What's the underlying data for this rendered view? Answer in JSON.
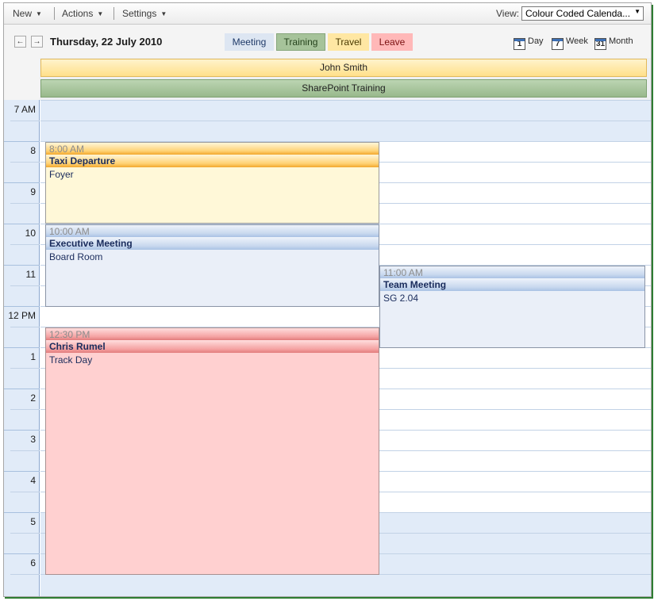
{
  "toolbar": {
    "new_label": "New",
    "actions_label": "Actions",
    "settings_label": "Settings",
    "view_label": "View:",
    "view_value": "Colour Coded Calenda..."
  },
  "header": {
    "prev_icon": "arrow-left-icon",
    "next_icon": "arrow-right-icon",
    "prev_glyph": "←",
    "next_glyph": "→",
    "date": "Thursday, 22 July 2010"
  },
  "legend": {
    "meeting": "Meeting",
    "training": "Training",
    "travel": "Travel",
    "leave": "Leave"
  },
  "views": {
    "day": {
      "label": "Day",
      "num": "1"
    },
    "week": {
      "label": "Week",
      "num": "7"
    },
    "month": {
      "label": "Month",
      "num": "31"
    }
  },
  "all_day": {
    "travel_event": "John Smith",
    "training_event": "SharePoint Training"
  },
  "hours": [
    "7 AM",
    "8",
    "9",
    "10",
    "11",
    "12 PM",
    "1",
    "2",
    "3",
    "4",
    "5",
    "6"
  ],
  "events": {
    "taxi": {
      "time": "8:00 AM",
      "title": "Taxi Departure",
      "location": "Foyer"
    },
    "exec": {
      "time": "10:00 AM",
      "title": "Executive Meeting",
      "location": "Board Room"
    },
    "team": {
      "time": "11:00 AM",
      "title": "Team Meeting",
      "location": "SG 2.04"
    },
    "leave": {
      "time": "12:30 PM",
      "title": "Chris Rumel",
      "location": "Track Day"
    }
  },
  "colors": {
    "meeting": "#dde6f2",
    "training": "#a6c39a",
    "travel": "#ffe7a3",
    "leave": "#ffb8b8"
  }
}
